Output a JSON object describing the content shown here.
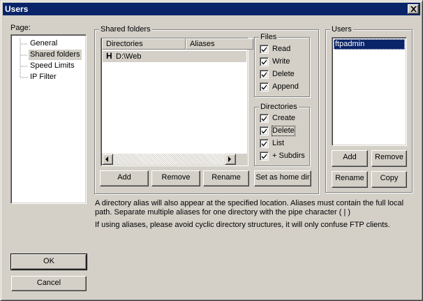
{
  "window": {
    "title": "Users"
  },
  "page_panel": {
    "label": "Page:",
    "items": [
      {
        "label": "General",
        "selected": false
      },
      {
        "label": "Shared folders",
        "selected": true
      },
      {
        "label": "Speed Limits",
        "selected": false
      },
      {
        "label": "IP Filter",
        "selected": false
      }
    ]
  },
  "shared_folders": {
    "group_label": "Shared folders",
    "columns": [
      "Directories",
      "Aliases"
    ],
    "rows": [
      {
        "flag": "H",
        "directory": "D:\\Web",
        "alias": ""
      }
    ],
    "buttons": {
      "add": "Add",
      "remove": "Remove",
      "rename": "Rename",
      "set_home": "Set as home dir"
    }
  },
  "files": {
    "group_label": "Files",
    "items": [
      {
        "label": "Read",
        "checked": true
      },
      {
        "label": "Write",
        "checked": true
      },
      {
        "label": "Delete",
        "checked": true
      },
      {
        "label": "Append",
        "checked": true
      }
    ]
  },
  "directories": {
    "group_label": "Directories",
    "items": [
      {
        "label": "Create",
        "checked": true
      },
      {
        "label": "Delete",
        "checked": true
      },
      {
        "label": "List",
        "checked": true
      },
      {
        "label": "+ Subdirs",
        "checked": true
      }
    ]
  },
  "users": {
    "group_label": "Users",
    "list": [
      "ftpadmin"
    ],
    "selected_index": 0,
    "buttons": {
      "add": "Add",
      "remove": "Remove",
      "rename": "Rename",
      "copy": "Copy"
    }
  },
  "help_text": {
    "line1": "A directory alias will also appear at the specified location. Aliases must contain the full local",
    "line2": "path. Separate multiple aliases for one directory with the pipe character ( | )",
    "line3": "If using aliases, please avoid cyclic directory structures, it will only confuse FTP clients."
  },
  "dialog_buttons": {
    "ok": "OK",
    "cancel": "Cancel"
  },
  "colors": {
    "title_bar": "#0a246a",
    "selection": "#0a246a",
    "face": "#d4d0c8"
  }
}
